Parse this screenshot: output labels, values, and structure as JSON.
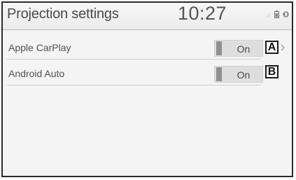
{
  "header": {
    "title": "Projection settings",
    "clock": "10:27",
    "status_icons": [
      "signal-icon",
      "battery-icon",
      "bluetooth-icon"
    ]
  },
  "settings": [
    {
      "label": "Apple CarPlay",
      "state": "On",
      "callout": "A"
    },
    {
      "label": "Android Auto",
      "state": "On",
      "callout": "B"
    }
  ],
  "colors": {
    "background": "#f4f4f4",
    "text": "#505050",
    "toggle_bg": "#dedede",
    "toggle_indicator": "#8f8f8f"
  }
}
